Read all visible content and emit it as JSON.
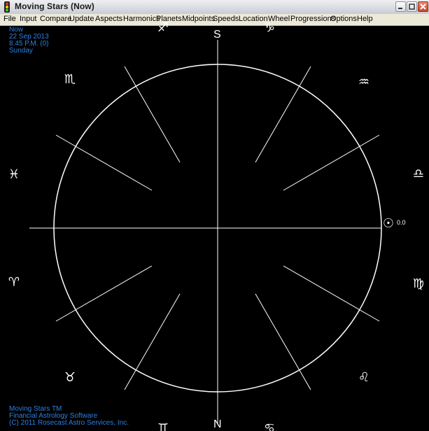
{
  "window": {
    "title": "Moving Stars (Now)"
  },
  "menu": [
    "File",
    "Input",
    "Compare",
    "Update",
    "Aspects",
    "Harmonics",
    "Planets",
    "Midpoints",
    "Speeds",
    "Location",
    "Wheel",
    "Progressions",
    "Options",
    "Help"
  ],
  "info_top": [
    "Now",
    "22 Sep 2013",
    "8.45 P.M. (0)",
    "Sunday"
  ],
  "info_bottom": [
    "Moving Stars TM",
    "Financial Astrology Software",
    "(C) 2011 Rosecast Astro Services, Inc."
  ],
  "compass": {
    "south": "S",
    "north": "N"
  },
  "zodiac": {
    "sagittarius": "♐",
    "capricorn": "♑",
    "scorpio": "♏",
    "aquarius": "♒",
    "pisces": "♓",
    "libra": "♎",
    "aries": "♈",
    "virgo": "♍",
    "taurus": "♉",
    "leo": "♌",
    "gemini": "♊",
    "cancer": "♋"
  },
  "planet": {
    "name": "sun",
    "symbol": "☉",
    "value": "0.0"
  },
  "colors": {
    "info_text": "#2f7fe0",
    "wheel": "#ffffff",
    "background": "#000000"
  }
}
